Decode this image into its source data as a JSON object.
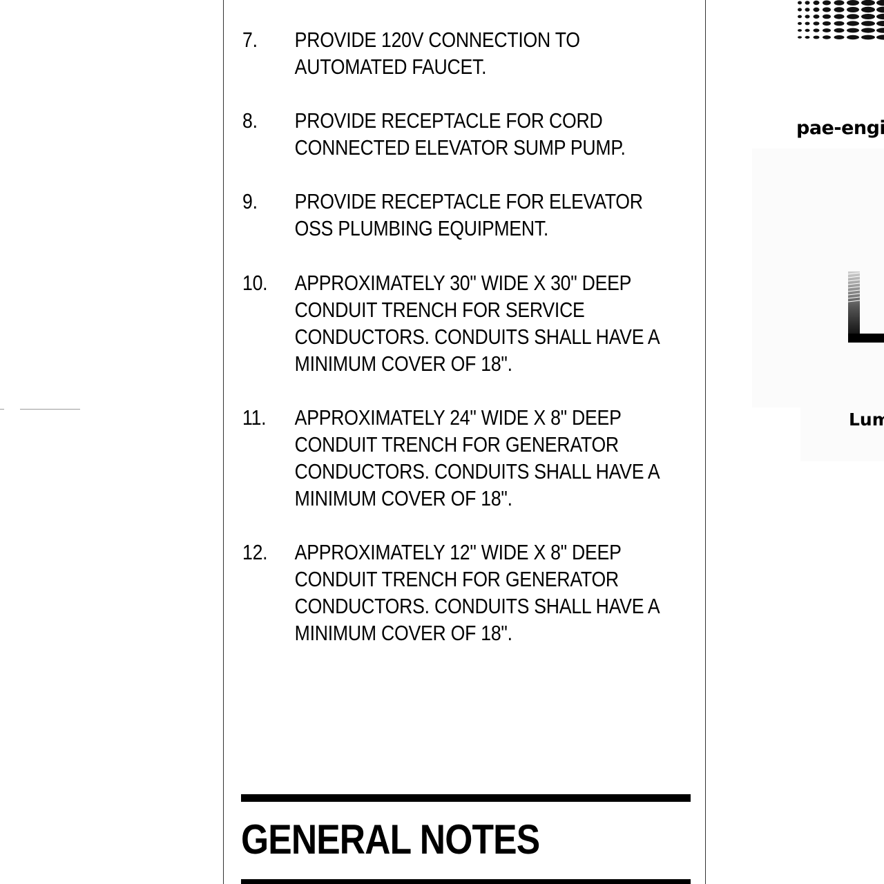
{
  "notes": [
    {
      "number": "7.",
      "text": "PROVIDE 120V CONNECTION TO\nAUTOMATED FAUCET."
    },
    {
      "number": "8.",
      "text": "PROVIDE RECEPTACLE FOR CORD\nCONNECTED ELEVATOR SUMP PUMP."
    },
    {
      "number": "9.",
      "text": "PROVIDE RECEPTACLE FOR ELEVATOR\nOSS PLUMBING EQUIPMENT."
    },
    {
      "number": "10.",
      "text": "APPROXIMATELY 30\" WIDE X 30\" DEEP\nCONDUIT TRENCH FOR SERVICE\nCONDUCTORS. CONDUITS SHALL HAVE A\nMINIMUM COVER OF 18\"."
    },
    {
      "number": "11.",
      "text": "APPROXIMATELY 24\" WIDE X 8\" DEEP\nCONDUIT TRENCH FOR GENERATOR\nCONDUCTORS. CONDUITS SHALL HAVE A\nMINIMUM COVER OF 18\"."
    },
    {
      "number": "12.",
      "text": "APPROXIMATELY 12\" WIDE X 8\" DEEP\nCONDUIT TRENCH FOR GENERATOR\nCONDUCTORS. CONDUITS SHALL HAVE A\nMINIMUM COVER OF 18\"."
    }
  ],
  "general_notes": {
    "title": "GENERAL NOTES"
  },
  "title_block": {
    "firm_website_fragment": "pae-engi",
    "client_fragment": "Lum",
    "logo_icon": "dot-pattern-logo-icon",
    "stamp_letter_icon": "large-letter-l-icon"
  }
}
